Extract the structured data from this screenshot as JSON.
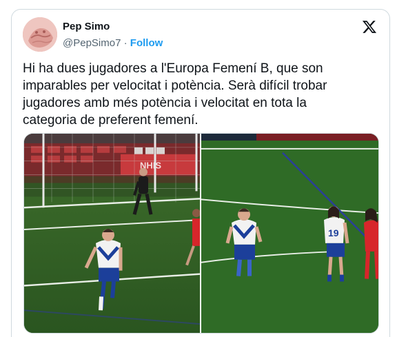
{
  "author": {
    "name": "Pep Simo",
    "handle": "@PepSimo7",
    "separator": "·",
    "follow_label": "Follow"
  },
  "tweet": {
    "text_lines": [
      "Hi ha dues jugadores a l'Europa Femení B, que son",
      "imparables per velocitat i potència. Serà difícil trobar",
      "jugadores amb més potència i velocitat en tota la",
      "categoria de preferent femení."
    ]
  },
  "media": {
    "photos": [
      {
        "name": "left-photo",
        "description_icon": "soccer-photo-icon",
        "jersey_number": "",
        "banner_text": "NHIS"
      },
      {
        "name": "right-photo",
        "description_icon": "soccer-photo-icon",
        "jersey_number": "19"
      }
    ]
  },
  "colors": {
    "accent": "#1d9bf0",
    "text": "#0f1419",
    "muted": "#536471",
    "pitch": "#2f5a22",
    "kit_blue": "#1c3f9a",
    "kit_red": "#d7262b"
  },
  "icons": {
    "brand": "x-logo-icon"
  }
}
